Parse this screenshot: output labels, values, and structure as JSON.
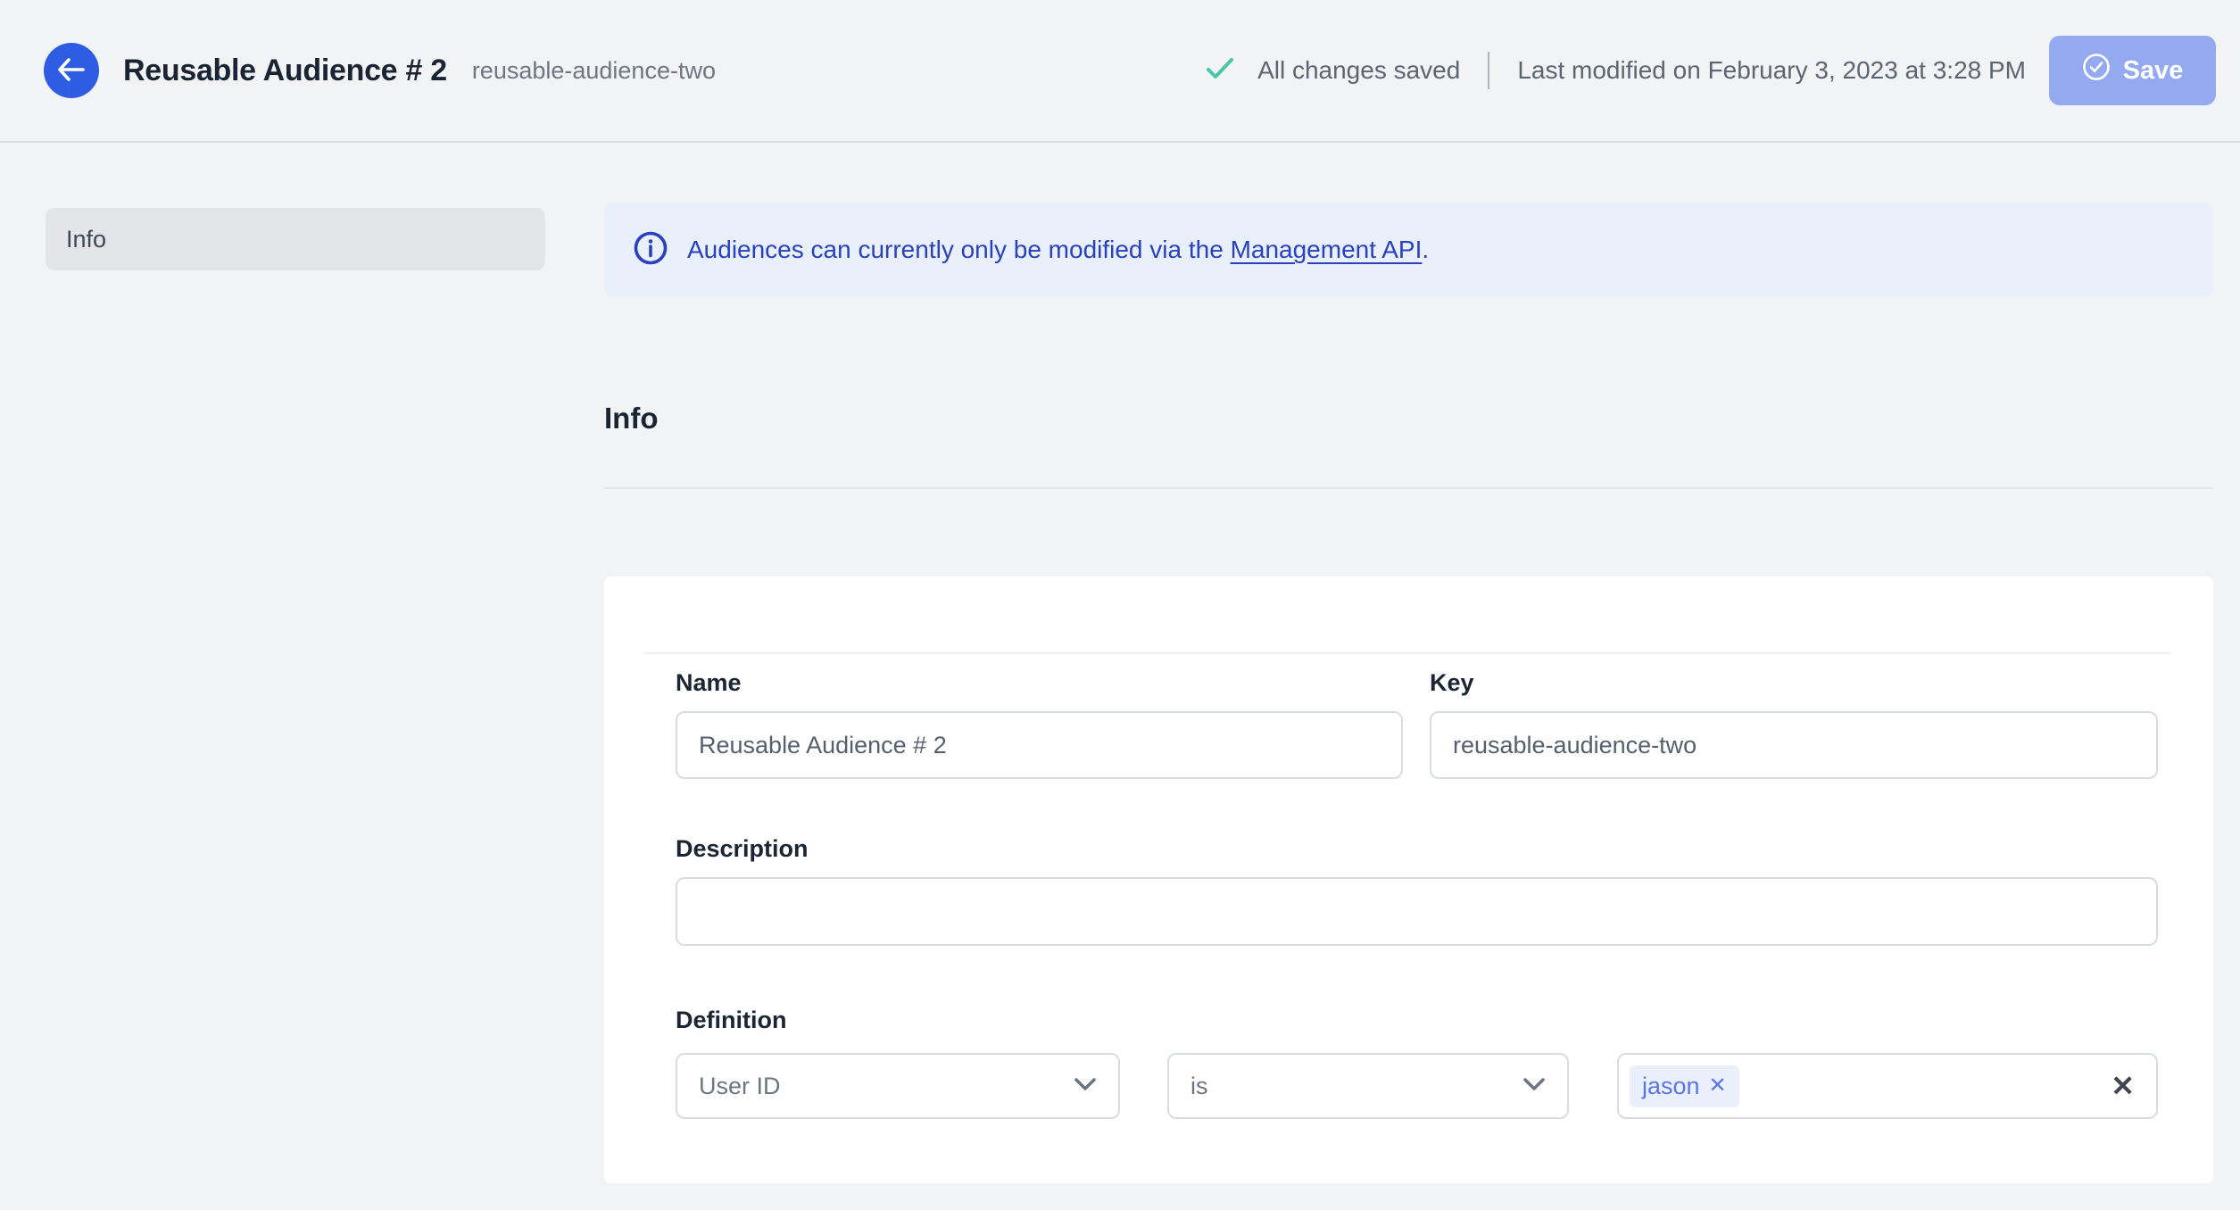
{
  "header": {
    "title": "Reusable Audience # 2",
    "subtitle": "reusable-audience-two",
    "status_text": "All changes saved",
    "last_modified": "Last modified on February 3, 2023 at 3:28 PM",
    "save_label": "Save",
    "icons": {
      "back": "arrow-left-icon",
      "status": "check-icon",
      "save": "circle-check-icon"
    }
  },
  "sidebar": {
    "items": [
      {
        "label": "Info",
        "active": true
      }
    ]
  },
  "banner": {
    "icon": "info-circle-icon",
    "text_before_link": "Audiences can currently only be modified via the ",
    "link_text": "Management API",
    "text_after_link": "."
  },
  "section": {
    "heading": "Info"
  },
  "form": {
    "name": {
      "label": "Name",
      "value": "Reusable Audience # 2"
    },
    "key": {
      "label": "Key",
      "value": "reusable-audience-two"
    },
    "description": {
      "label": "Description",
      "value": ""
    },
    "definition": {
      "label": "Definition",
      "attribute_selected": "User ID",
      "operator_selected": "is",
      "values": [
        "jason"
      ],
      "chip_remove_icon": "x-icon",
      "clear_icon": "x-icon"
    }
  },
  "colors": {
    "page_bg": "#f2f3f5",
    "card_bg": "#ffffff",
    "back_button_blue": "#2e5ce2",
    "save_button_blue": "#95a9f0",
    "banner_bg": "#e9f0fb",
    "banner_text_blue": "#2a41bd",
    "status_check_teal": "#4cc6ab",
    "chip_bg": "#eaeffc",
    "chip_text_blue": "#5b74e8",
    "input_border": "#d9dce0",
    "heading_text": "#1b2433",
    "muted_text": "#5d6572"
  }
}
